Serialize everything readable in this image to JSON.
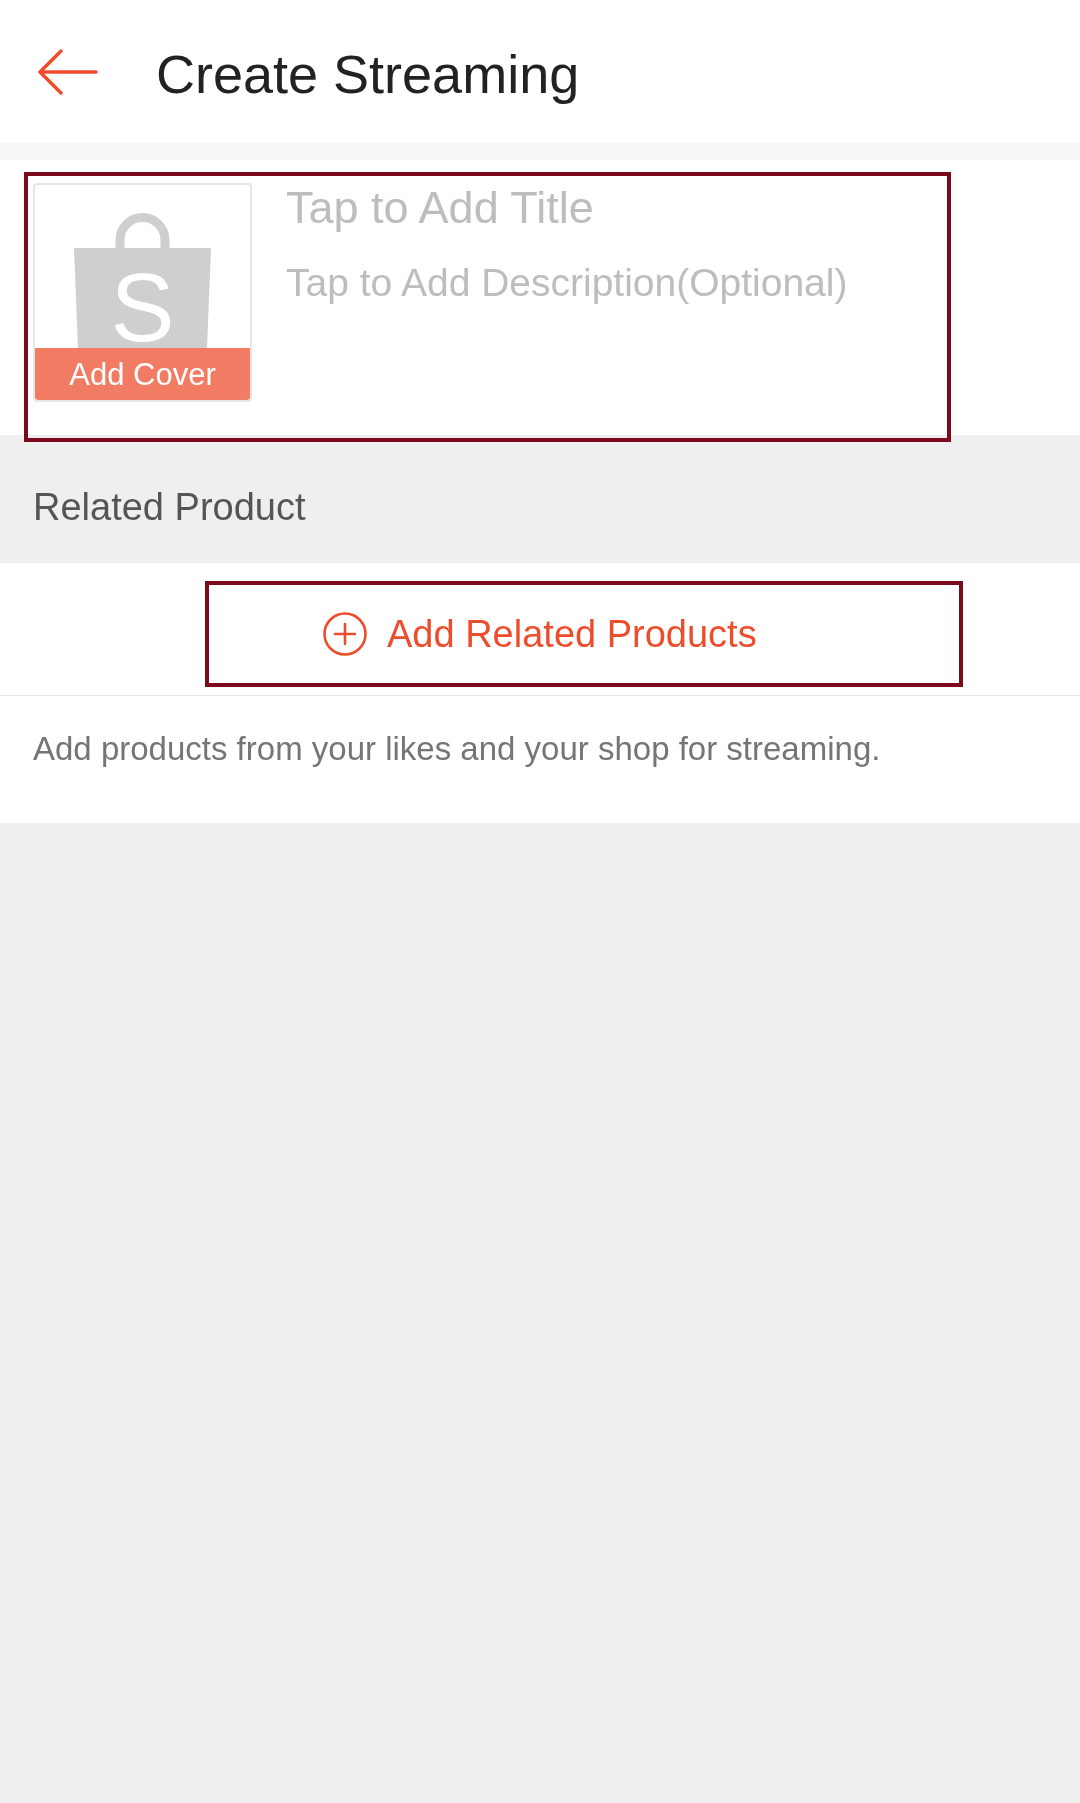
{
  "header": {
    "title": "Create Streaming"
  },
  "stream_info": {
    "highlighted": true,
    "cover": {
      "logo_letter": "S",
      "label": "Add Cover"
    },
    "title": {
      "placeholder": "Tap to Add Title"
    },
    "description": {
      "placeholder": "Tap to Add Description(Optional)"
    }
  },
  "related_products": {
    "heading": "Related Product",
    "add_button": {
      "label": "Add Related Products",
      "highlighted": true
    },
    "hint": "Add products from your likes and your shop for streaming."
  }
}
